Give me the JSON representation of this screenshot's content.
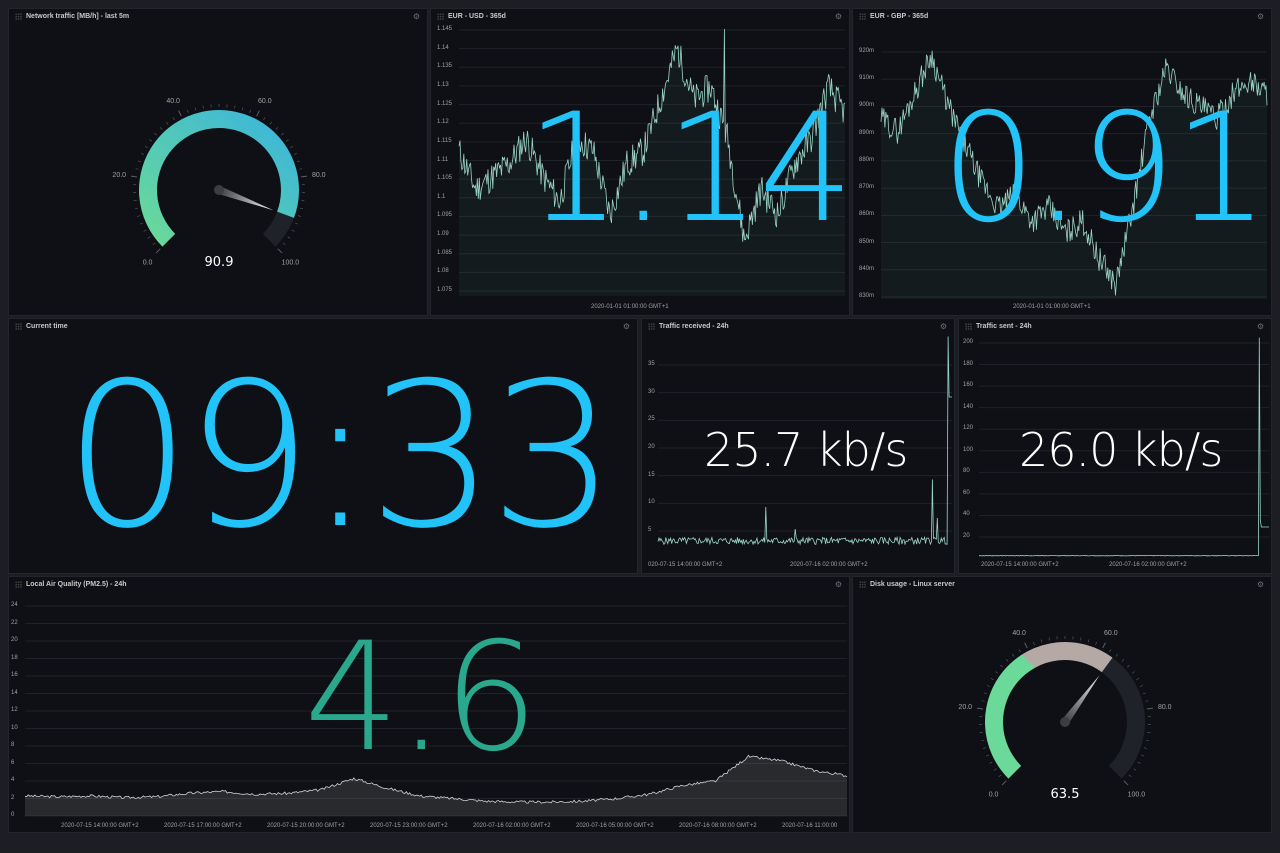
{
  "colors": {
    "accent_blue": "#22c3f8",
    "accent_green": "#2aa88c",
    "gauge_green": "#6ad999",
    "gauge_blue": "#3ab5dc",
    "gauge_taupe": "#b5a9a5",
    "series_line": "#9ad4c4"
  },
  "panels": {
    "network": {
      "title": "Network traffic [MB/h] - last 5m",
      "value": "90.9",
      "value_num": 90.9,
      "min": 0,
      "max": 100,
      "labels": [
        "0.0",
        "20.0",
        "40.0",
        "60.0",
        "80.0",
        "100.0"
      ]
    },
    "eurusd": {
      "title": "EUR - USD - 365d",
      "big_value": "1.14",
      "y_ticks": [
        "1.145",
        "1.14",
        "1.135",
        "1.13",
        "1.125",
        "1.12",
        "1.115",
        "1.11",
        "1.105",
        "1.1",
        "1.095",
        "1.09",
        "1.085",
        "1.08",
        "1.075"
      ],
      "x_label": "2020-01-01 01:00:00 GMT+1"
    },
    "eurgbp": {
      "title": "EUR - GBP - 365d",
      "big_value": "0.91",
      "y_ticks": [
        "920m",
        "910m",
        "900m",
        "890m",
        "880m",
        "870m",
        "860m",
        "850m",
        "840m",
        "830m"
      ],
      "x_label": "2020-01-01 01:00:00 GMT+1"
    },
    "time": {
      "title": "Current time",
      "big_value": "09:33"
    },
    "received": {
      "title": "Traffic received - 24h",
      "big_value": "25.7 kb/s",
      "y_ticks": [
        "35",
        "30",
        "25",
        "20",
        "15",
        "10",
        "5"
      ],
      "x_labels": [
        "020-07-15 14:00:00 GMT+2",
        "2020-07-16 02:00:00 GMT+2"
      ]
    },
    "sent": {
      "title": "Traffic sent - 24h",
      "big_value": "26.0 kb/s",
      "y_ticks": [
        "200",
        "180",
        "160",
        "140",
        "120",
        "100",
        "80",
        "60",
        "40",
        "20"
      ],
      "x_labels": [
        "2020-07-15 14:00:00 GMT+2",
        "2020-07-16 02:00:00 GMT+2"
      ]
    },
    "air": {
      "title": "Local Air Quality (PM2.5) - 24h",
      "big_value": "4.6",
      "y_ticks": [
        "24",
        "22",
        "20",
        "18",
        "16",
        "14",
        "12",
        "10",
        "8",
        "6",
        "4",
        "2",
        "0"
      ],
      "x_labels": [
        "2020-07-15 14:00:00 GMT+2",
        "2020-07-15 17:00:00 GMT+2",
        "2020-07-15 20:00:00 GMT+2",
        "2020-07-15 23:00:00 GMT+2",
        "2020-07-16 02:00:00 GMT+2",
        "2020-07-16 05:00:00 GMT+2",
        "2020-07-16 08:00:00 GMT+2",
        "2020-07-16 11:00:00"
      ]
    },
    "disk": {
      "title": "Disk usage - Linux server",
      "value": "63.5",
      "value_num": 63.5,
      "min": 0,
      "max": 100,
      "labels": [
        "0.0",
        "20.0",
        "40.0",
        "60.0",
        "80.0",
        "100.0"
      ]
    }
  }
}
